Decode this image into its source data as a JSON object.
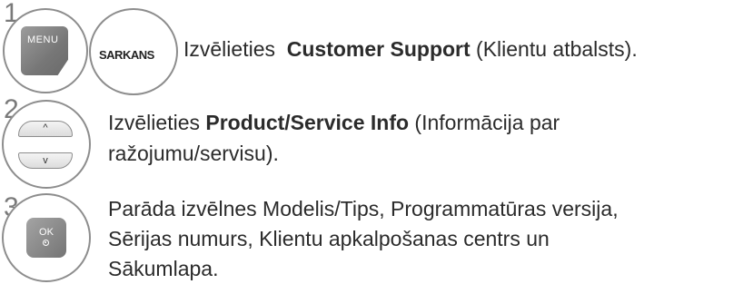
{
  "steps": [
    {
      "number": "1",
      "keys": [
        "MENU",
        "SARKANS"
      ],
      "text_before": "Izvēlieties  ",
      "text_bold": "Customer Support",
      "text_after": " (Klientu atbalsts)."
    },
    {
      "number": "2",
      "keys": [
        "^",
        "v"
      ],
      "text_before": "Izvēlieties ",
      "text_bold": "Product/Service Info",
      "text_after": " (Informācija par",
      "text_line2": "ražojumu/servisu)."
    },
    {
      "number": "3",
      "keys": [
        "OK"
      ],
      "line1": "Parāda izvēlnes Modelis/Tips, Programmatūras versija,",
      "line2": "Sērijas numurs, Klientu apkalpošanas centrs un",
      "line3": "Sākumlapa."
    }
  ]
}
